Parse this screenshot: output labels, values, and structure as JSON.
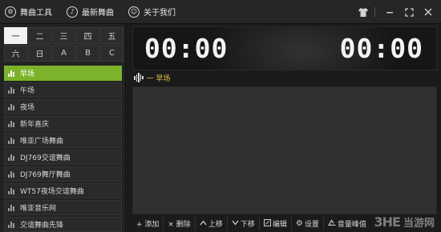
{
  "titlebar": {
    "items": [
      {
        "label": "舞曲工具",
        "icon": "tools-icon"
      },
      {
        "label": "最新舞曲",
        "icon": "music-note-icon"
      },
      {
        "label": "关于我们",
        "icon": "info-icon"
      }
    ],
    "controls": [
      "shirt-icon",
      "minimize-icon",
      "fullscreen-icon",
      "close-icon"
    ]
  },
  "grid": {
    "buttons": [
      "一",
      "二",
      "三",
      "四",
      "五",
      "六",
      "日",
      "A",
      "B",
      "C"
    ],
    "active_index": 0
  },
  "categories": {
    "items": [
      "早场",
      "午场",
      "夜场",
      "新年喜庆",
      "唯亚广场舞曲",
      "DJ769交谊舞曲",
      "DJ769舞厅舞曲",
      "WT57夜场交谊舞曲",
      "唯亚音乐网",
      "交谊舞曲先锋"
    ],
    "active_index": 0
  },
  "player": {
    "time_left": "00:00",
    "time_right": "00:00",
    "now_playing": "一  早场"
  },
  "toolbar": {
    "add": "+ 添加",
    "delete": "× 删除",
    "up": "上移",
    "down": "下移",
    "edit": "编辑",
    "settings": "设置",
    "peak": "音量峰值"
  },
  "watermark": {
    "logo": "3HE",
    "text": "当游网"
  },
  "colors": {
    "accent": "#7cb32a",
    "now_playing": "#e6c23a",
    "background": "#1b1b1b"
  }
}
